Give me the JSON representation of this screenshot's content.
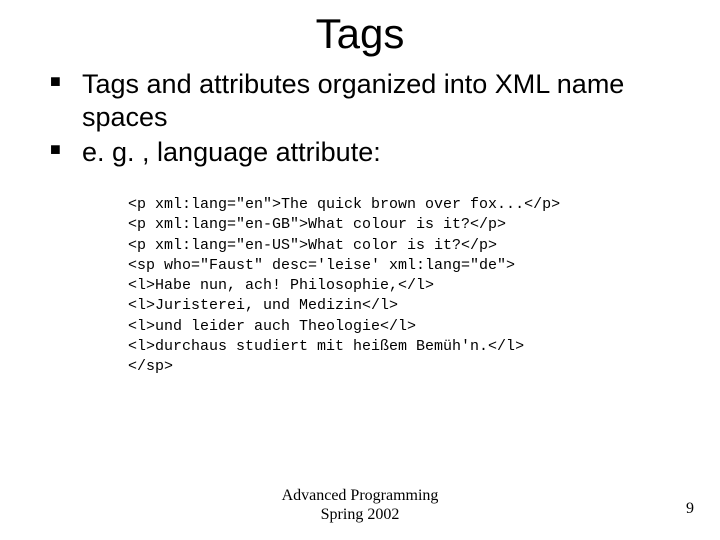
{
  "title": "Tags",
  "bullets": [
    "Tags and attributes organized into XML name spaces",
    "e. g. , language attribute:"
  ],
  "code_lines": [
    "<p xml:lang=\"en\">The quick brown over fox...</p>",
    "<p xml:lang=\"en-GB\">What colour is it?</p>",
    "<p xml:lang=\"en-US\">What color is it?</p>",
    "<sp who=\"Faust\" desc='leise' xml:lang=\"de\">",
    "<l>Habe nun, ach! Philosophie,</l>",
    "<l>Juristerei, und Medizin</l>",
    "<l>und leider auch Theologie</l>",
    "<l>durchaus studiert mit heißem Bemüh'n.</l>",
    "</sp>"
  ],
  "footer": {
    "line1": "Advanced Programming",
    "line2": "Spring 2002"
  },
  "page_number": "9"
}
